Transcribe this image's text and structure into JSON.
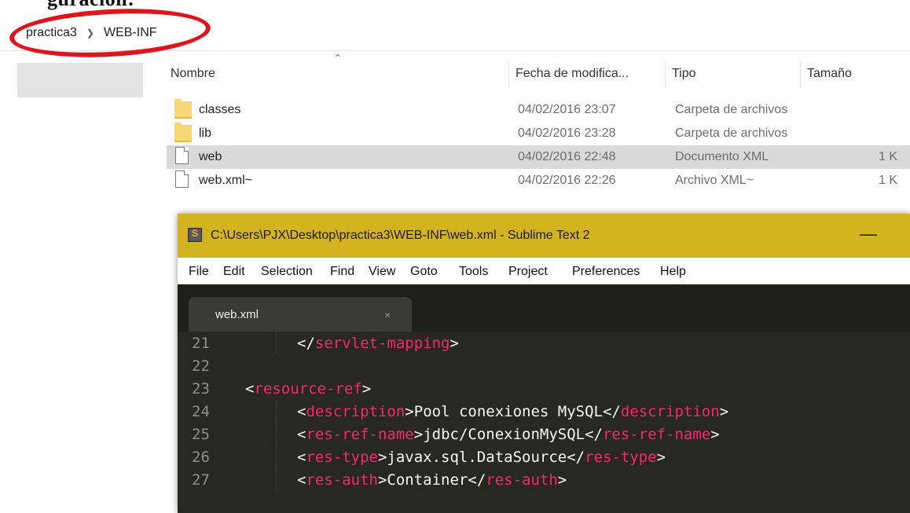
{
  "explorer": {
    "top_heading_fragment": "guración:",
    "breadcrumb": [
      "practica3",
      "WEB-INF"
    ],
    "columns": {
      "name": "Nombre",
      "date": "Fecha de modifica...",
      "type": "Tipo",
      "size": "Tamaño"
    },
    "files": [
      {
        "name": "classes",
        "date": "04/02/2016 23:07",
        "type": "Carpeta de archivos",
        "size": "",
        "icon": "folder-icon",
        "selected": false
      },
      {
        "name": "lib",
        "date": "04/02/2016 23:28",
        "type": "Carpeta de archivos",
        "size": "",
        "icon": "folder-icon",
        "selected": false
      },
      {
        "name": "web",
        "date": "04/02/2016 22:48",
        "type": "Documento XML",
        "size": "1 K",
        "icon": "file-icon",
        "selected": true
      },
      {
        "name": "web.xml~",
        "date": "04/02/2016 22:26",
        "type": "Archivo XML~",
        "size": "1 K",
        "icon": "file-icon",
        "selected": false
      }
    ],
    "annotation_color": "#e0151c"
  },
  "sublime": {
    "title": "C:\\Users\\PJX\\Desktop\\practica3\\WEB-INF\\web.xml - Sublime Text 2",
    "minimize_label": "—",
    "menu": [
      "File",
      "Edit",
      "Selection",
      "Find",
      "View",
      "Goto",
      "Tools",
      "Project",
      "Preferences",
      "Help"
    ],
    "tab": {
      "label": "web.xml",
      "close": "×"
    },
    "colors": {
      "titlebar": "#d4b320",
      "editor_bg": "#272822",
      "tag": "#f92672",
      "text": "#f8f8f2",
      "line_number": "#8f908a"
    },
    "lines": [
      {
        "n": "21",
        "indent": 2,
        "open": "</",
        "tag": "servlet-mapping",
        "close": ">",
        "text": "",
        "end_open": "",
        "end_tag": "",
        "end_close": ""
      },
      {
        "n": "22",
        "indent": 0,
        "open": "",
        "tag": "",
        "close": "",
        "text": "",
        "end_open": "",
        "end_tag": "",
        "end_close": ""
      },
      {
        "n": "23",
        "indent": 1,
        "open": "<",
        "tag": "resource-ref",
        "close": ">",
        "text": "",
        "end_open": "",
        "end_tag": "",
        "end_close": ""
      },
      {
        "n": "24",
        "indent": 2,
        "open": "<",
        "tag": "description",
        "close": ">",
        "text": "Pool conexiones MySQL",
        "end_open": "</",
        "end_tag": "description",
        "end_close": ">"
      },
      {
        "n": "25",
        "indent": 2,
        "open": "<",
        "tag": "res-ref-name",
        "close": ">",
        "text": "jdbc/ConexionMySQL",
        "end_open": "</",
        "end_tag": "res-ref-name",
        "end_close": ">"
      },
      {
        "n": "26",
        "indent": 2,
        "open": "<",
        "tag": "res-type",
        "close": ">",
        "text": "javax.sql.DataSource",
        "end_open": "</",
        "end_tag": "res-type",
        "end_close": ">"
      },
      {
        "n": "27",
        "indent": 2,
        "open": "<",
        "tag": "res-auth",
        "close": ">",
        "text": "Container",
        "end_open": "</",
        "end_tag": "res-auth",
        "end_close": ">"
      }
    ]
  }
}
